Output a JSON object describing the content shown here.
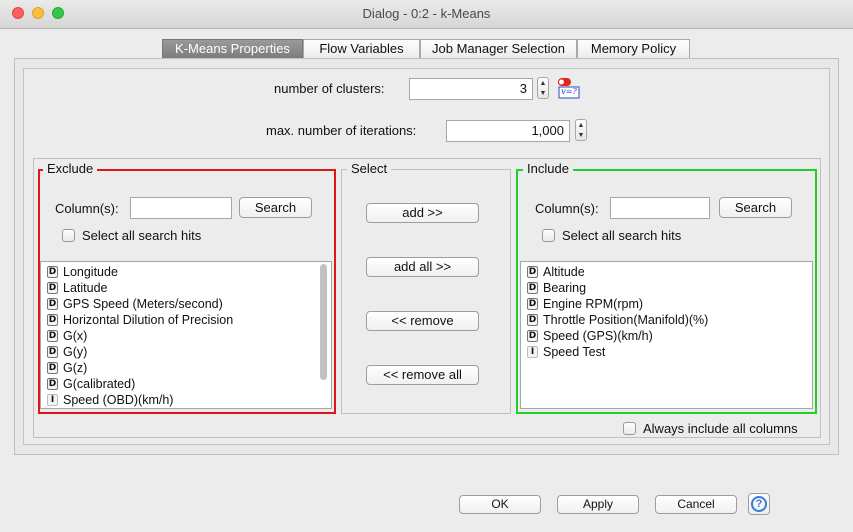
{
  "window": {
    "title": "Dialog - 0:2 - k-Means",
    "controls": {
      "close_color": "#fc605c",
      "minimize_color": "#fdbc40",
      "zoom_color": "#34c84a"
    }
  },
  "tabs": [
    {
      "label": "K-Means Properties",
      "active": true
    },
    {
      "label": "Flow Variables",
      "active": false
    },
    {
      "label": "Job Manager Selection",
      "active": false
    },
    {
      "label": "Memory Policy",
      "active": false
    }
  ],
  "settings": {
    "clusters_label": "number of clusters:",
    "clusters_value": "3",
    "flow_var_badge": "v=?",
    "iterations_label": "max. number of iterations:",
    "iterations_value": "1,000"
  },
  "exclude": {
    "title": "Exclude",
    "border_color": "#e0151c",
    "columns_label": "Column(s):",
    "search_button": "Search",
    "select_all_label": "Select all search hits",
    "items": [
      {
        "type": "D",
        "name": "Longitude"
      },
      {
        "type": "D",
        "name": "Latitude"
      },
      {
        "type": "D",
        "name": "GPS Speed (Meters/second)"
      },
      {
        "type": "D",
        "name": "Horizontal Dilution of Precision"
      },
      {
        "type": "D",
        "name": "G(x)"
      },
      {
        "type": "D",
        "name": "G(y)"
      },
      {
        "type": "D",
        "name": "G(z)"
      },
      {
        "type": "D",
        "name": "G(calibrated)"
      },
      {
        "type": "I",
        "name": "Speed (OBD)(km/h)"
      }
    ]
  },
  "select": {
    "title": "Select",
    "add": "add >>",
    "add_all": "add all >>",
    "remove": "<< remove",
    "remove_all": "<< remove all"
  },
  "include": {
    "title": "Include",
    "border_color": "#1fcf2a",
    "columns_label": "Column(s):",
    "search_button": "Search",
    "select_all_label": "Select all search hits",
    "items": [
      {
        "type": "D",
        "name": "Altitude"
      },
      {
        "type": "D",
        "name": "Bearing"
      },
      {
        "type": "D",
        "name": "Engine RPM(rpm)"
      },
      {
        "type": "D",
        "name": "Throttle Position(Manifold)(%)"
      },
      {
        "type": "D",
        "name": "Speed (GPS)(km/h)"
      },
      {
        "type": "I",
        "name": "Speed Test"
      }
    ]
  },
  "always_include_label": "Always include all columns",
  "footer": {
    "ok": "OK",
    "apply": "Apply",
    "cancel": "Cancel",
    "help": "?"
  }
}
